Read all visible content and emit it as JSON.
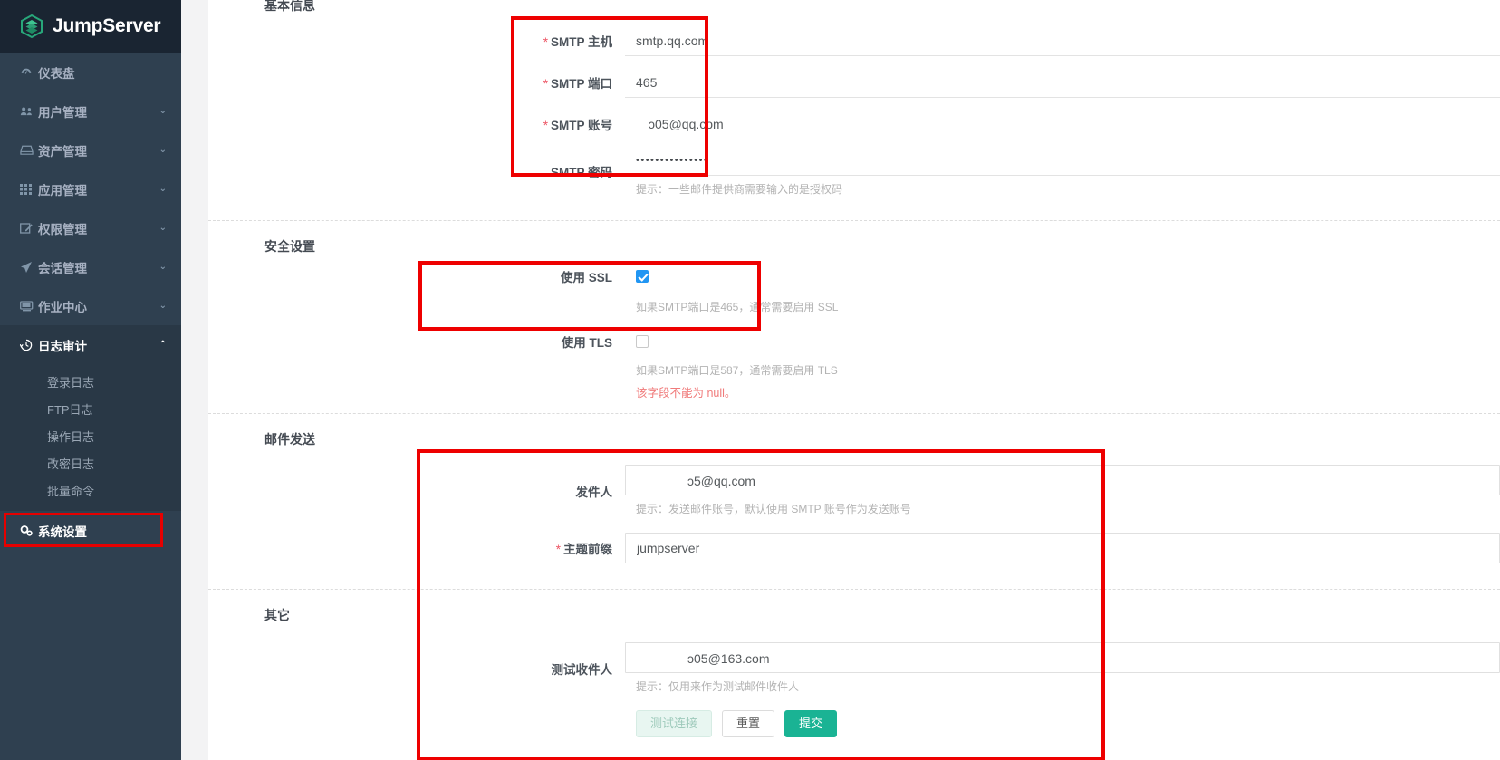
{
  "brand": {
    "name": "JumpServer",
    "logo_icon": "jumpserver-logo-icon"
  },
  "sidebar": {
    "items": [
      {
        "label": "仪表盘",
        "icon": "dashboard-icon",
        "caret": ""
      },
      {
        "label": "用户管理",
        "icon": "users-icon",
        "caret": "⌄"
      },
      {
        "label": "资产管理",
        "icon": "assets-icon",
        "caret": "⌄"
      },
      {
        "label": "应用管理",
        "icon": "apps-grid-icon",
        "caret": "⌄"
      },
      {
        "label": "权限管理",
        "icon": "permissions-edit-icon",
        "caret": "⌄"
      },
      {
        "label": "会话管理",
        "icon": "sessions-rocket-icon",
        "caret": "⌄"
      },
      {
        "label": "作业中心",
        "icon": "jobs-terminal-icon",
        "caret": "⌄"
      },
      {
        "label": "日志审计",
        "icon": "audit-history-icon",
        "caret": "⌃"
      }
    ],
    "audit_children": [
      {
        "label": "登录日志"
      },
      {
        "label": "FTP日志"
      },
      {
        "label": "操作日志"
      },
      {
        "label": "改密日志"
      },
      {
        "label": "批量命令"
      }
    ],
    "system_settings": {
      "label": "系统设置",
      "icon": "settings-gears-icon"
    }
  },
  "sections": {
    "basic": {
      "title": "基本信息",
      "fields": {
        "host": {
          "label": "SMTP 主机",
          "required": true,
          "value": "smtp.qq.com"
        },
        "port": {
          "label": "SMTP 端口",
          "required": true,
          "value": "465"
        },
        "account": {
          "label": "SMTP 账号",
          "required": true,
          "value_prefix": "​",
          "value": "ɔ05@qq.com"
        },
        "password": {
          "label": "SMTP 密码",
          "required": false,
          "value": "•••••••••••••••"
        }
      },
      "hint": "提示：一些邮件提供商需要输入的是授权码"
    },
    "security": {
      "title": "安全设置",
      "ssl": {
        "label": "使用 SSL",
        "checked": true,
        "hint": "如果SMTP端口是465，通常需要启用 SSL"
      },
      "tls": {
        "label": "使用 TLS",
        "checked": false,
        "hint": "如果SMTP端口是587，通常需要启用 TLS",
        "error": "该字段不能为 null。"
      }
    },
    "send": {
      "title": "邮件发送",
      "sender": {
        "label": "发件人",
        "required": false,
        "value": "ɔ5@qq.com",
        "hint": "提示：发送邮件账号，默认使用 SMTP 账号作为发送账号"
      },
      "subject_prefix": {
        "label": "主题前缀",
        "required": true,
        "value": "jumpserver"
      }
    },
    "other": {
      "title": "其它",
      "test_recipient": {
        "label": "测试收件人",
        "required": false,
        "value": "ɔ05@163.com",
        "hint": "提示：仅用来作为测试邮件收件人"
      },
      "buttons": {
        "test": "测试连接",
        "reset": "重置",
        "submit": "提交"
      }
    }
  },
  "colors": {
    "annotation": "#ee0000",
    "primary_green": "#1ab394",
    "sidebar_bg": "#2f4050",
    "checkbox_blue": "#2196f3",
    "error_red": "#f07b7b"
  }
}
